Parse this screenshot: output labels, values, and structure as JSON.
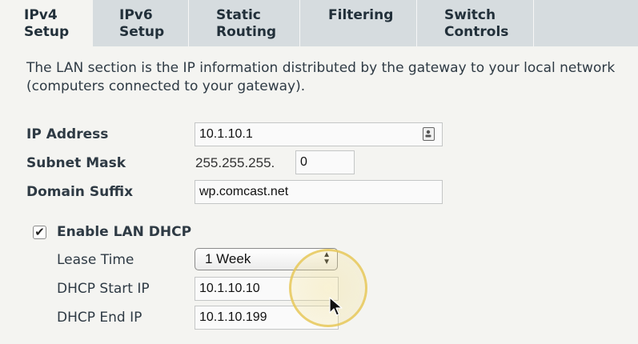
{
  "tabs": [
    {
      "line1": "IPv4",
      "line2": "Setup"
    },
    {
      "line1": "IPv6",
      "line2": "Setup"
    },
    {
      "line1": "Static",
      "line2": "Routing"
    },
    {
      "line1": "Filtering",
      "line2": ""
    },
    {
      "line1": "Switch",
      "line2": "Controls"
    }
  ],
  "active_tab": "IPv4 Setup",
  "description": "The LAN section is the IP information distributed by the gateway to your local network (computers connected to your gateway).",
  "ip_address": {
    "label": "IP Address",
    "value": "10.1.10.1"
  },
  "subnet_mask": {
    "label": "Subnet Mask",
    "prefix": "255.255.255.",
    "value": "0"
  },
  "domain_suffix": {
    "label": "Domain Suffix",
    "value": "wp.comcast.net"
  },
  "dhcp": {
    "enable_label": "Enable LAN DHCP",
    "enabled": true,
    "checkmark": "✔",
    "lease_time": {
      "label": "Lease Time",
      "value": "1 Week"
    },
    "start_ip": {
      "label": "DHCP Start IP",
      "value": "10.1.10.10"
    },
    "end_ip": {
      "label": "DHCP End IP",
      "value": "10.1.10.199"
    }
  },
  "colors": {
    "tabbar": "#d6dcdf",
    "background": "#f4f4f1",
    "highlight": "#e6c85a"
  },
  "icons": [
    "contact-card-icon",
    "checkbox-checked-icon",
    "select-arrows-icon",
    "mouse-pointer-icon"
  ]
}
